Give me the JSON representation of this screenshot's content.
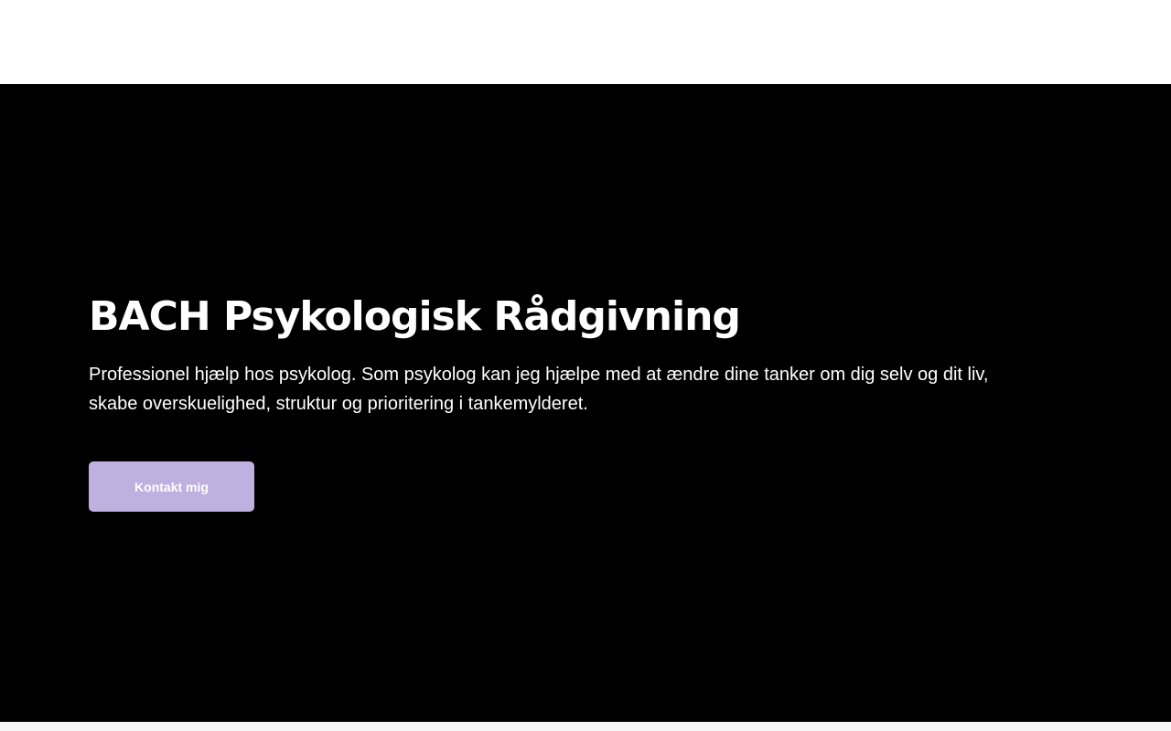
{
  "hero": {
    "title": "BACH Psykologisk Rådgivning",
    "subtitle": "Professionel hjælp hos psykolog. Som psykolog kan jeg hjælpe med at ændre dine tanker om dig selv og dit liv, skabe overskuelighed, struktur og prioritering i tankemylderet.",
    "cta_label": "Kontakt mig"
  },
  "colors": {
    "header_bg": "#ffffff",
    "hero_bg": "#000000",
    "text": "#ffffff",
    "button_bg": "#c0b0df"
  }
}
